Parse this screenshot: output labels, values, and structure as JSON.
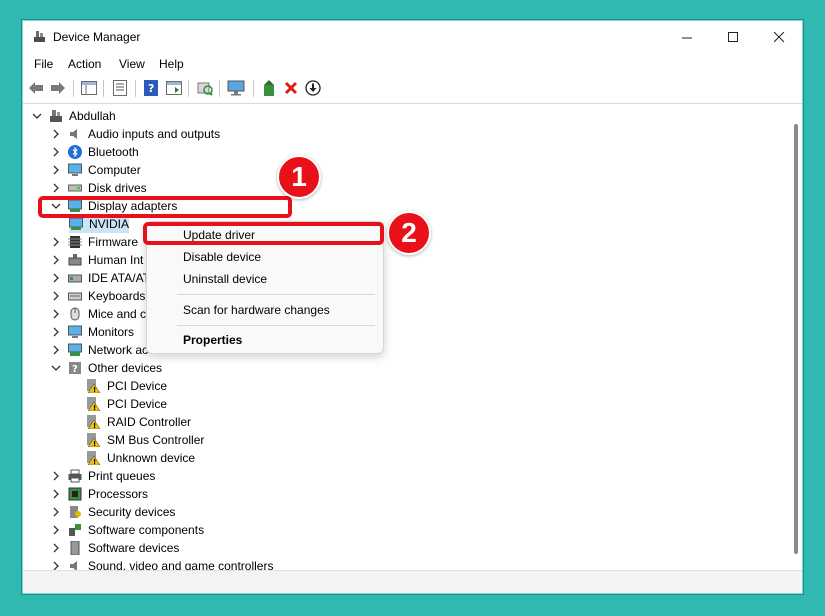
{
  "window": {
    "title": "Device Manager"
  },
  "menu": [
    "File",
    "Action",
    "View",
    "Help"
  ],
  "tree": {
    "root": "Abdullah",
    "categories": [
      "Audio inputs and outputs",
      "Bluetooth",
      "Computer",
      "Disk drives",
      "Display adapters",
      "NVIDIA",
      "Firmware",
      "Human Int",
      "IDE ATA/AT",
      "Keyboards",
      "Mice and c",
      "Monitors",
      "Network ac",
      "Other devices",
      "PCI Device",
      "PCI Device",
      "RAID Controller",
      "SM Bus Controller",
      "Unknown device",
      "Print queues",
      "Processors",
      "Security devices",
      "Software components",
      "Software devices",
      "Sound, video and game controllers"
    ]
  },
  "context_menu": {
    "update": "Update driver",
    "disable": "Disable device",
    "uninstall": "Uninstall device",
    "scan": "Scan for hardware changes",
    "properties": "Properties"
  },
  "annotations": {
    "step1": "1",
    "step2": "2"
  },
  "colors": {
    "highlight": "#e8111a",
    "background": "#2fb9b1"
  }
}
